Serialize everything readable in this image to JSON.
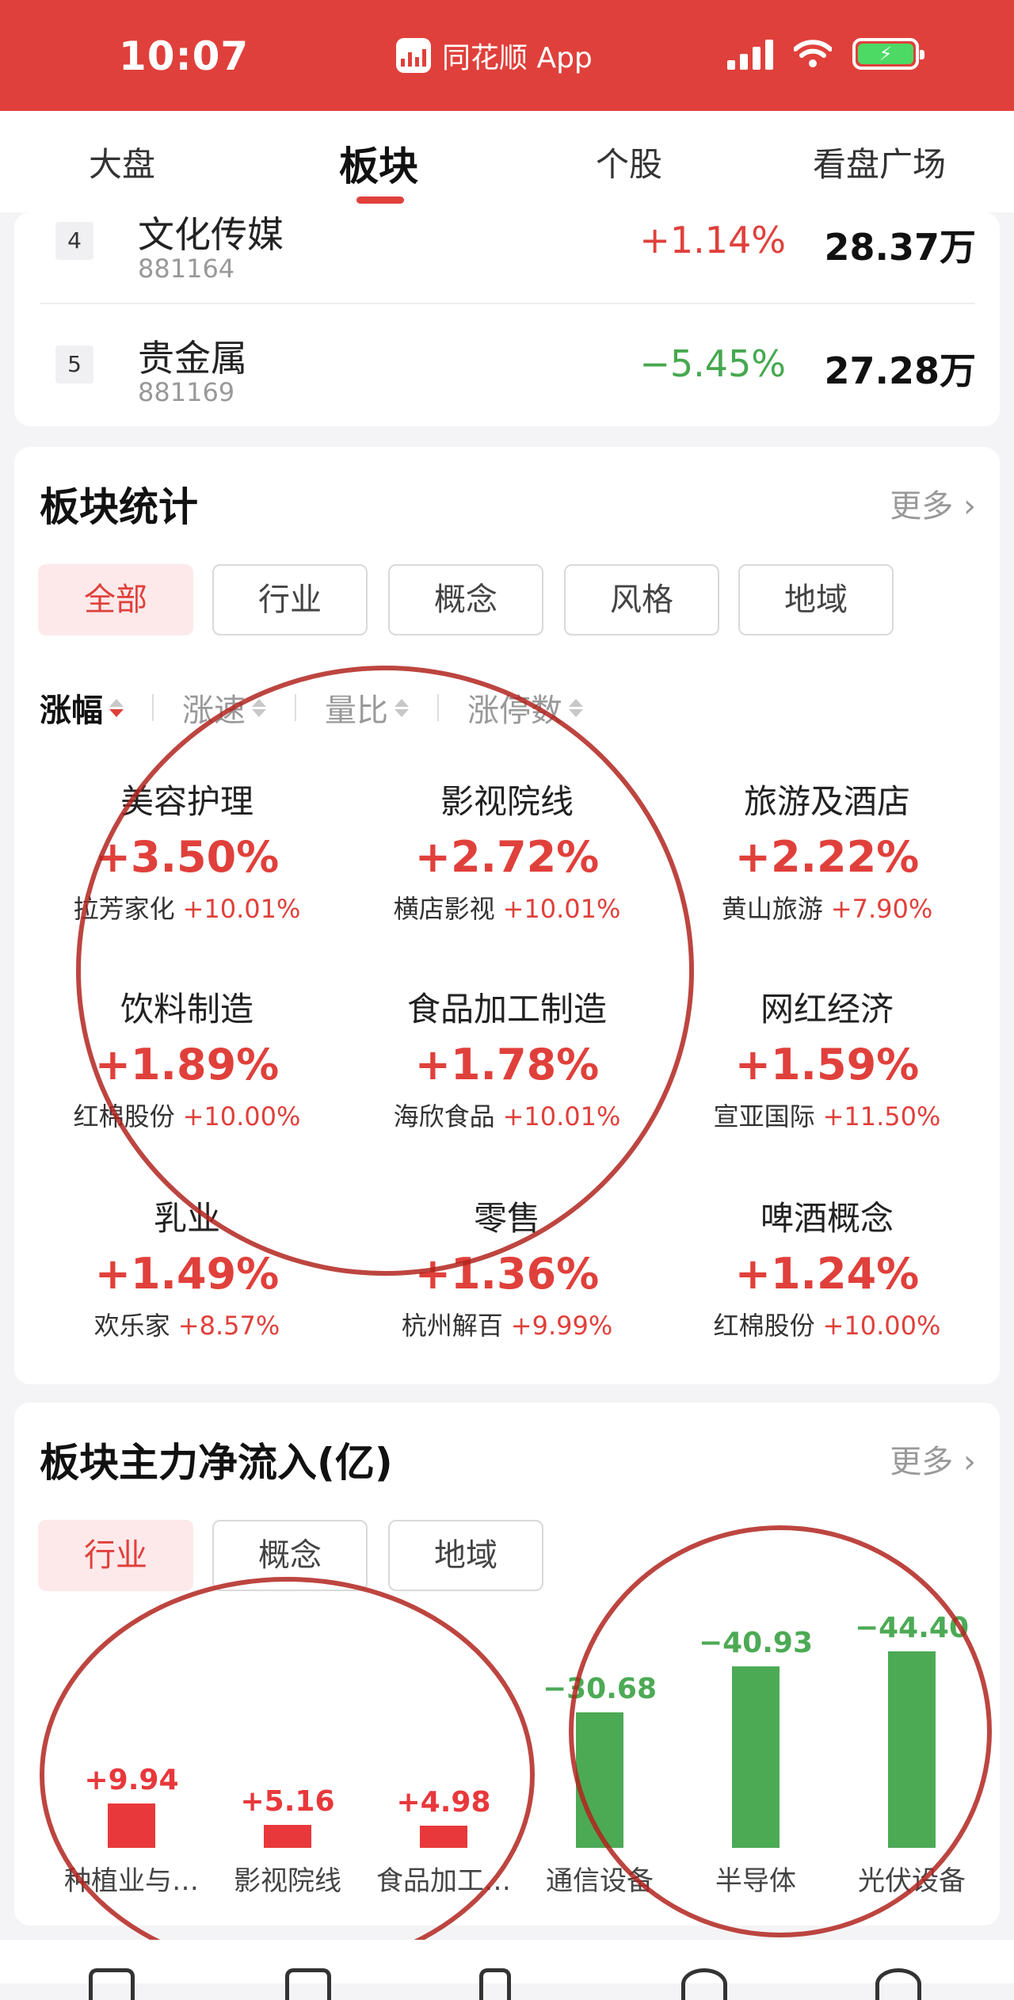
{
  "status_bar": {
    "time": "10:07",
    "app_name": "同花顺 App",
    "battery_icon": "charging-battery-icon"
  },
  "top_tabs": [
    {
      "label": "大盘",
      "active": false
    },
    {
      "label": "板块",
      "active": true
    },
    {
      "label": "个股",
      "active": false
    },
    {
      "label": "看盘广场",
      "active": false
    }
  ],
  "ranking": [
    {
      "rank": "4",
      "name": "文化传媒",
      "code": "881164",
      "change": "+1.14%",
      "amount": "28.37万"
    },
    {
      "rank": "5",
      "name": "贵金属",
      "code": "881169",
      "change": "−5.45%",
      "amount": "27.28万"
    }
  ],
  "sector_stats": {
    "title": "板块统计",
    "more": "更多",
    "filters": [
      "全部",
      "行业",
      "概念",
      "风格",
      "地域"
    ],
    "sort_options": [
      "涨幅",
      "涨速",
      "量比",
      "涨停数"
    ],
    "items": [
      {
        "name": "美容护理",
        "change": "+3.50%",
        "lead_stock": "拉芳家化",
        "lead_change": "+10.01%"
      },
      {
        "name": "影视院线",
        "change": "+2.72%",
        "lead_stock": "横店影视",
        "lead_change": "+10.01%"
      },
      {
        "name": "旅游及酒店",
        "change": "+2.22%",
        "lead_stock": "黄山旅游",
        "lead_change": "+7.90%"
      },
      {
        "name": "饮料制造",
        "change": "+1.89%",
        "lead_stock": "红棉股份",
        "lead_change": "+10.00%"
      },
      {
        "name": "食品加工制造",
        "change": "+1.78%",
        "lead_stock": "海欣食品",
        "lead_change": "+10.01%"
      },
      {
        "name": "网红经济",
        "change": "+1.59%",
        "lead_stock": "宣亚国际",
        "lead_change": "+11.50%"
      },
      {
        "name": "乳业",
        "change": "+1.49%",
        "lead_stock": "欢乐家",
        "lead_change": "+8.57%"
      },
      {
        "name": "零售",
        "change": "+1.36%",
        "lead_stock": "杭州解百",
        "lead_change": "+9.99%"
      },
      {
        "name": "啤酒概念",
        "change": "+1.24%",
        "lead_stock": "红棉股份",
        "lead_change": "+10.00%"
      }
    ]
  },
  "net_inflow": {
    "title": "板块主力净流入(亿)",
    "more": "更多",
    "filters": [
      "行业",
      "概念",
      "地域"
    ],
    "positive_color": "#e8383b",
    "negative_color": "#4caa55"
  },
  "chart_data": {
    "type": "bar",
    "categories": [
      "种植业与…",
      "影视院线",
      "食品加工…",
      "通信设备",
      "半导体",
      "光伏设备"
    ],
    "values": [
      9.94,
      5.16,
      4.98,
      -30.68,
      -40.93,
      -44.4
    ],
    "value_labels": [
      "+9.94",
      "+5.16",
      "+4.98",
      "−30.68",
      "−40.93",
      "−44.40"
    ],
    "title": "板块主力净流入(亿)"
  }
}
